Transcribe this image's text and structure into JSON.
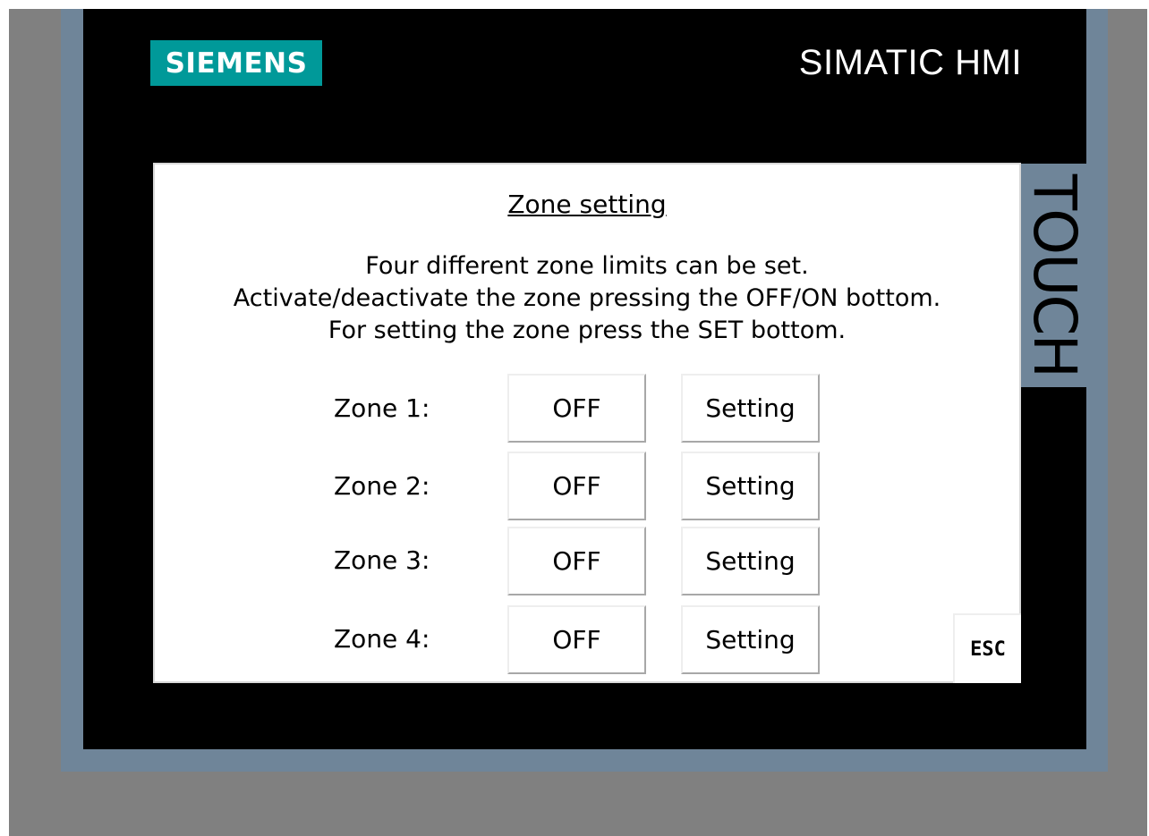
{
  "header": {
    "brand": "SIEMENS",
    "product": "SIMATIC HMI",
    "side_label": "TOUCH"
  },
  "screen": {
    "title": "Zone setting",
    "description": [
      "Four different zone limits can be set.",
      "Activate/deactivate the zone pressing the OFF/ON bottom.",
      "For setting the zone press the SET bottom."
    ],
    "zones": [
      {
        "label": "Zone 1:",
        "toggle": "OFF",
        "setting": "Setting"
      },
      {
        "label": "Zone 2:",
        "toggle": "OFF",
        "setting": "Setting"
      },
      {
        "label": "Zone 3:",
        "toggle": "OFF",
        "setting": "Setting"
      },
      {
        "label": "Zone 4:",
        "toggle": "OFF",
        "setting": "Setting"
      }
    ],
    "esc_label": "ESC"
  },
  "colors": {
    "brand_teal": "#009999",
    "bezel_blue": "#6f8599",
    "panel_black": "#000000",
    "outer_gray": "#808080"
  }
}
